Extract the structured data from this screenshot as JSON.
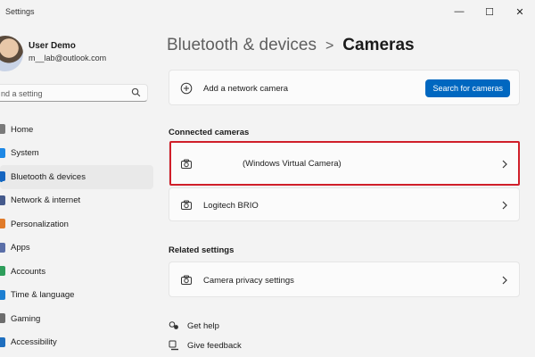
{
  "window": {
    "title": "Settings",
    "controls": {
      "minimize": "—",
      "maximize": "☐",
      "close": "✕"
    }
  },
  "user": {
    "name": "User Demo",
    "email": "m__lab@outlook.com"
  },
  "search": {
    "placeholder": "nd a setting",
    "icon": "search-icon"
  },
  "sidebar": {
    "items": [
      {
        "label": "Home",
        "icon": "home-icon",
        "color": "#7a7a7a"
      },
      {
        "label": "System",
        "icon": "system-icon",
        "color": "#1e88e5"
      },
      {
        "label": "Bluetooth & devices",
        "icon": "bluetooth-icon",
        "color": "#1565c0",
        "active": true
      },
      {
        "label": "Network & internet",
        "icon": "network-icon",
        "color": "#455a8c"
      },
      {
        "label": "Personalization",
        "icon": "personalization-icon",
        "color": "#e07b2a"
      },
      {
        "label": "Apps",
        "icon": "apps-icon",
        "color": "#5b6fa8"
      },
      {
        "label": "Accounts",
        "icon": "accounts-icon",
        "color": "#2e9e5b"
      },
      {
        "label": "Time & language",
        "icon": "time-language-icon",
        "color": "#1d7fd1"
      },
      {
        "label": "Gaming",
        "icon": "gaming-icon",
        "color": "#6d6d6d"
      },
      {
        "label": "Accessibility",
        "icon": "accessibility-icon",
        "color": "#1f6fbf"
      }
    ]
  },
  "breadcrumb": {
    "parent": "Bluetooth & devices",
    "separator": ">",
    "current": "Cameras"
  },
  "add_network_camera": {
    "label": "Add a network camera",
    "button": "Search for cameras"
  },
  "connected_cameras": {
    "title": "Connected cameras",
    "items": [
      {
        "label": "(Windows Virtual Camera)",
        "highlighted": true
      },
      {
        "label": "Logitech BRIO",
        "highlighted": false
      }
    ]
  },
  "related_settings": {
    "title": "Related settings",
    "items": [
      {
        "label": "Camera privacy settings"
      }
    ]
  },
  "footer": {
    "get_help": "Get help",
    "give_feedback": "Give feedback"
  },
  "colors": {
    "accent": "#0067c0",
    "highlight": "#d01f2a"
  }
}
